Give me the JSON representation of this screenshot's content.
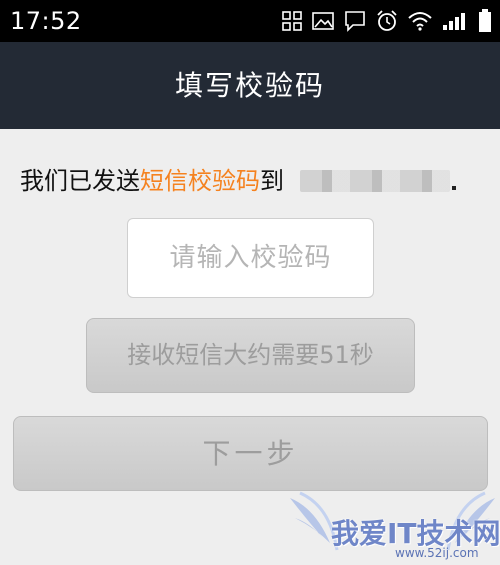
{
  "status_bar": {
    "time": "17:52",
    "icons": [
      "grid-icon",
      "image-icon",
      "message-icon",
      "alarm-icon",
      "wifi-icon",
      "signal-icon",
      "battery-icon"
    ]
  },
  "header": {
    "title": "填写校验码"
  },
  "main": {
    "sent_prefix": "我们已发送",
    "sent_highlight": "短信校验码",
    "sent_suffix": "到",
    "code_input": {
      "placeholder": "请输入校验码",
      "value": ""
    },
    "sms_wait_button": "接收短信大约需要51秒",
    "next_button": "下一步"
  },
  "watermark": {
    "text": "我爱IT技术网",
    "url": "www.52ij.com"
  },
  "colors": {
    "header_bg": "#232a35",
    "highlight": "#f5821f",
    "button_bg": "#d0d0d0",
    "button_text": "#9d9d9d",
    "page_bg": "#eeeeee"
  }
}
